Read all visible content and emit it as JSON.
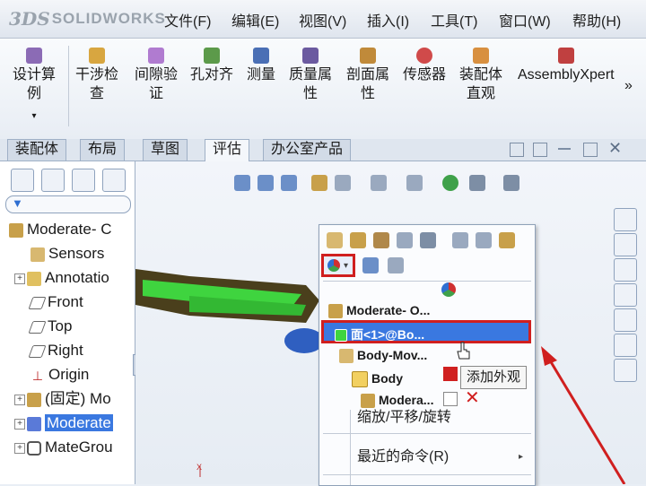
{
  "app": {
    "logo_prefix": "3DS",
    "logo_word": "SOLIDWORKS"
  },
  "menu": [
    "文件(F)",
    "编辑(E)",
    "视图(V)",
    "插入(I)",
    "工具(T)",
    "窗口(W)",
    "帮助(H)"
  ],
  "toolbar": {
    "tools": [
      {
        "line1": "设计算",
        "line2": "例",
        "icon": "design-study-icon"
      },
      {
        "line1": "干涉检",
        "line2": "查",
        "icon": "interference-icon"
      },
      {
        "line1": "间隙验",
        "line2": "证",
        "icon": "clearance-icon"
      },
      {
        "line1": "孔对齐",
        "line2": "",
        "icon": "hole-align-icon"
      },
      {
        "line1": "测量",
        "line2": "",
        "icon": "measure-icon"
      },
      {
        "line1": "质量属",
        "line2": "性",
        "icon": "mass-properties-icon"
      },
      {
        "line1": "剖面属",
        "line2": "性",
        "icon": "section-properties-icon"
      },
      {
        "line1": "传感器",
        "line2": "",
        "icon": "sensor-icon"
      },
      {
        "line1": "装配体",
        "line2": "直观",
        "icon": "assembly-visualization-icon"
      },
      {
        "line1": "AssemblyXpert",
        "line2": "",
        "icon": "assemblyxpert-icon"
      }
    ],
    "more": "»"
  },
  "tabs": [
    "装配体",
    "布局",
    "草图",
    "评估",
    "办公室产品"
  ],
  "active_tab": "评估",
  "tree": {
    "filter_icon": "filter-icon",
    "items": [
      {
        "label": "Moderate- C",
        "expander": "",
        "icon": "assembly-icon"
      },
      {
        "label": "Sensors",
        "expander": "",
        "icon": "sensor-folder-icon"
      },
      {
        "label": "Annotatio",
        "expander": "+",
        "icon": "annotation-icon"
      },
      {
        "label": "Front",
        "expander": "",
        "icon": "plane-icon"
      },
      {
        "label": "Top",
        "expander": "",
        "icon": "plane-icon"
      },
      {
        "label": "Right",
        "expander": "",
        "icon": "plane-icon"
      },
      {
        "label": "Origin",
        "expander": "",
        "icon": "origin-icon"
      },
      {
        "label": "(固定) Mo",
        "expander": "+",
        "icon": "part-icon"
      },
      {
        "label": "Moderate",
        "expander": "+",
        "icon": "part-icon"
      },
      {
        "label": "MateGrou",
        "expander": "+",
        "icon": "mate-group-icon"
      }
    ]
  },
  "context_menu": {
    "items": [
      {
        "label": "Moderate- O...",
        "type": "header"
      },
      {
        "label": "面<1>@Bo...",
        "type": "highlighted"
      },
      {
        "label": "Body-Mov...",
        "type": "tree"
      },
      {
        "label": "Body",
        "type": "tree"
      },
      {
        "label": "Modera...",
        "type": "tree"
      }
    ],
    "commands": [
      {
        "label": "缩放/平移/旋转",
        "arrow": "▸"
      },
      {
        "label": "最近的命令(R)",
        "arrow": "▸"
      }
    ],
    "tooltip": "添加外观"
  },
  "colors": {
    "accent": "#2f6fd1",
    "highlight_border": "#d01f1f",
    "selection": "#3a78e0",
    "model_green": "#3fd43f"
  }
}
